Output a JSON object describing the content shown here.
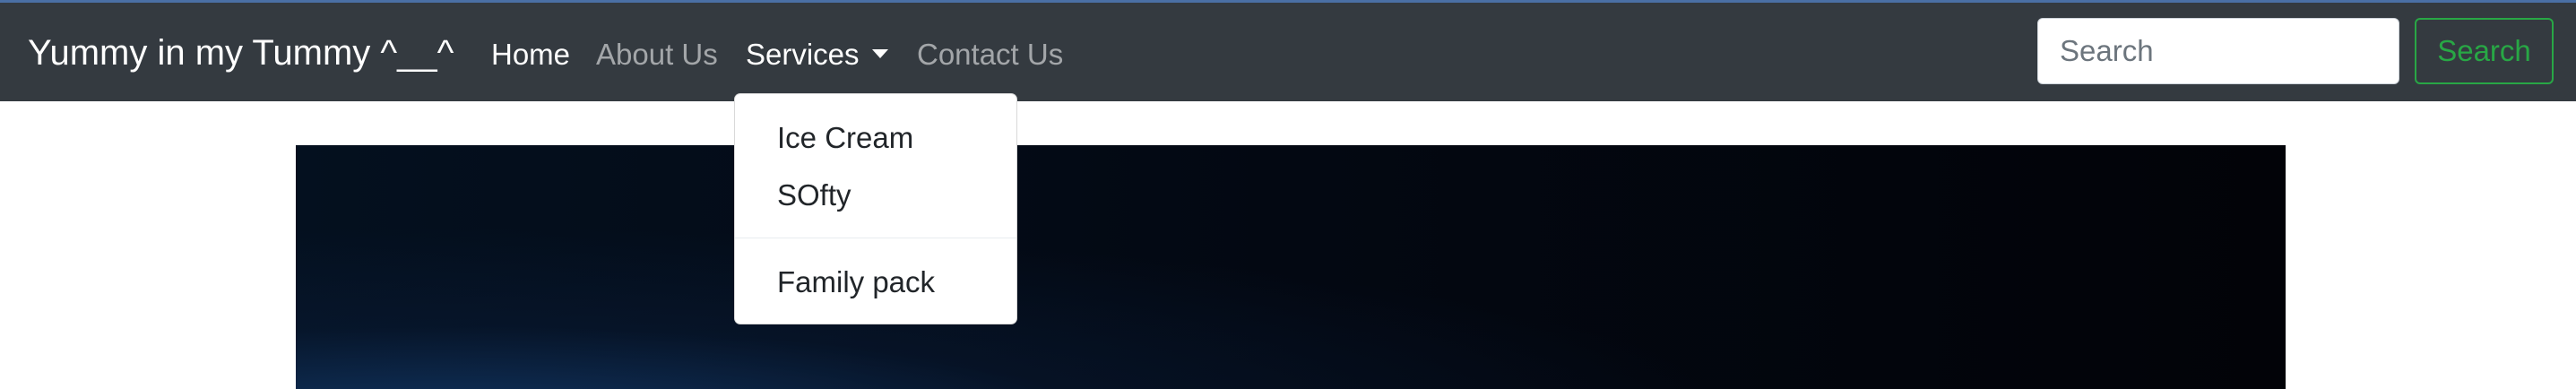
{
  "navbar": {
    "brand": "Yummy in my Tummy ^__^",
    "links": {
      "home": "Home",
      "about": "About Us",
      "services": "Services",
      "contact": "Contact Us"
    },
    "search": {
      "placeholder": "Search",
      "button_label": "Search"
    }
  },
  "dropdown": {
    "items": [
      "Ice Cream",
      "SOfty",
      "Family pack"
    ]
  },
  "colors": {
    "navbar_bg": "#343a40",
    "search_button": "#28a745",
    "hero_bg": "#030812"
  }
}
